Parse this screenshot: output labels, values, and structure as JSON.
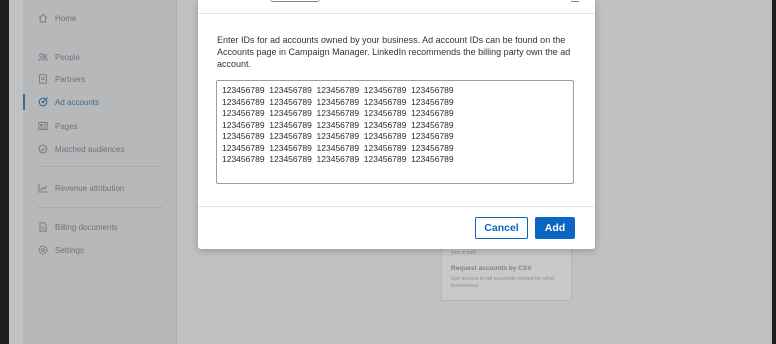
{
  "sidebar": {
    "items": [
      {
        "id": "home",
        "label": "Home",
        "icon": "home-icon",
        "active": false
      },
      {
        "id": "people",
        "label": "People",
        "icon": "people-icon",
        "active": false
      },
      {
        "id": "partners",
        "label": "Partners",
        "icon": "partners-icon",
        "active": false
      },
      {
        "id": "ad-accounts",
        "label": "Ad accounts",
        "icon": "target-icon",
        "active": true
      },
      {
        "id": "pages",
        "label": "Pages",
        "icon": "pages-icon",
        "active": false
      },
      {
        "id": "matched-audiences",
        "label": "Matched audiences",
        "icon": "audience-icon",
        "active": false
      },
      {
        "id": "revenue-attribution",
        "label": "Revenue attribution",
        "icon": "chart-icon",
        "active": false
      },
      {
        "id": "billing-documents",
        "label": "Billing documents",
        "icon": "document-icon",
        "active": false
      },
      {
        "id": "settings",
        "label": "Settings",
        "icon": "gear-icon",
        "active": false
      }
    ]
  },
  "background_card": {
    "small_text": "ions in bulk",
    "title": "Request accounts by CSV",
    "description": "Get access to ad accounts owned by other businesses"
  },
  "modal": {
    "description": "Enter IDs for ad accounts owned by your business. Ad account IDs can be found on the Accounts page in Campaign Manager. LinkedIn recommends the billing party own the ad account.",
    "textarea_value": "123456789  123456789  123456789  123456789  123456789\n123456789  123456789  123456789  123456789  123456789\n123456789  123456789  123456789  123456789  123456789\n123456789  123456789  123456789  123456789  123456789\n123456789  123456789  123456789  123456789  123456789\n123456789  123456789  123456789  123456789  123456789\n123456789  123456789  123456789  123456789  123456789",
    "cancel_label": "Cancel",
    "add_label": "Add"
  },
  "colors": {
    "primary": "#0a66c2",
    "overlay_bg": "#bfc1c3",
    "active_nav": "#3f6a8f"
  }
}
